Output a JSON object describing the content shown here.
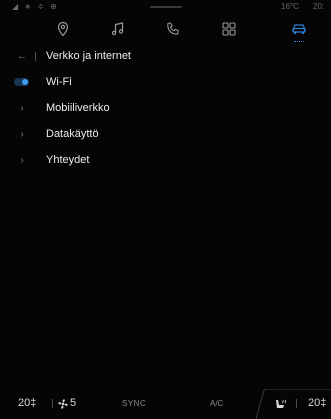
{
  "status": {
    "outside_temp": "16°C",
    "time": "20:"
  },
  "nav": {
    "items": [
      {
        "name": "nav-navigation",
        "icon": "location-pin-icon"
      },
      {
        "name": "nav-media",
        "icon": "music-note-icon"
      },
      {
        "name": "nav-phone",
        "icon": "phone-icon"
      },
      {
        "name": "nav-apps",
        "icon": "grid-icon"
      },
      {
        "name": "nav-vehicle",
        "icon": "car-icon",
        "active": true
      }
    ],
    "active_color": "#2d7fd3"
  },
  "menu": {
    "header": "Verkko ja internet",
    "items": [
      {
        "label": "Wi-Fi",
        "type": "toggle",
        "enabled": true
      },
      {
        "label": "Mobiiliverkko",
        "type": "chevron"
      },
      {
        "label": "Datakäyttö",
        "type": "chevron"
      },
      {
        "label": "Yhteydet",
        "type": "chevron"
      }
    ]
  },
  "climate": {
    "left_temp": "20‡",
    "fan_level": "5",
    "sync_label": "SYNC",
    "ac_label": "A/C",
    "right_temp": "20‡"
  }
}
